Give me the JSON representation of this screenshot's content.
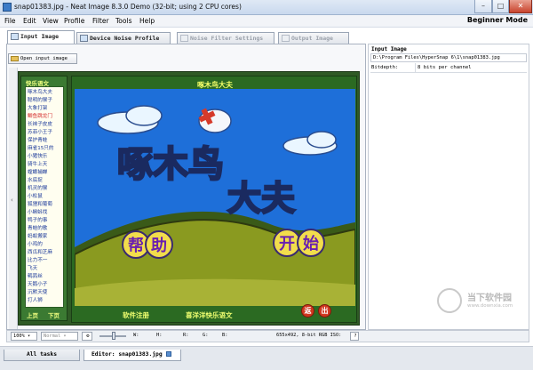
{
  "window": {
    "title": "snap01383.jpg - Neat Image 8.3.0 Demo (32-bit; using 2 CPU cores)",
    "controls": {
      "minimize": "–",
      "maximize": "□",
      "close": "✕"
    }
  },
  "menu": {
    "items": [
      "File",
      "Edit",
      "View",
      "Profile",
      "Filter",
      "Tools",
      "Help"
    ],
    "mode": "Beginner Mode"
  },
  "tabs": [
    {
      "label": "Input Image",
      "state": "active"
    },
    {
      "label": "Device Noise Profile",
      "state": "normal"
    },
    {
      "label": "Noise Filter Settings",
      "state": "disabled"
    },
    {
      "label": "Output Image",
      "state": "disabled"
    }
  ],
  "toolbar": {
    "open_label": "Open input image"
  },
  "image_content": {
    "sidebar_title": "快乐语文",
    "sidebar_items": [
      "啄木鸟大夫",
      "聪明的猴子",
      "大象打架",
      "鲫鱼跳龙门",
      "长袜子皮皮",
      "苏菲小王子",
      "保护青蛙",
      "麻雀15只的",
      "小猪快乐",
      "骑牛上天",
      "螳螂捕蝉",
      "水底捉",
      "机灵的猴",
      "小松鼠",
      "狐狸和葡萄",
      "小蝌蚪找",
      "鸭子的事",
      "青蛙的歌",
      "蚂蚁搬家",
      "小鸡的",
      "西瓜和芝麻",
      "比力不一",
      "飞天",
      "鹌鹑丝",
      "天鹅小子",
      "沉默天使",
      "打人狮"
    ],
    "sidebar_prev": "上页",
    "sidebar_next": "下页",
    "game_title": "啄木鸟大夫",
    "big_title_1": "啄木鸟",
    "big_title_2": "大夫",
    "help_1": "帮",
    "help_2": "助",
    "start_1": "开",
    "start_2": "始",
    "footer_left": "软件注册",
    "footer_right": "喜洋洋快乐语文",
    "btn_back": "返",
    "btn_exit": "出"
  },
  "right_panel": {
    "heading": "Input Image",
    "path": "D:\\Program Files\\HyperSnap 6\\1\\snap01383.jpg",
    "bitdepth_label": "Bitdepth:",
    "bitdepth_value": "8 bits per channel"
  },
  "statusbar": {
    "zoom": "100%",
    "view_mode": "Normal",
    "w_label": "W:",
    "h_label": "H:",
    "r_label": "R:",
    "g_label": "G:",
    "b_label": "B:",
    "info": "655x492, 8-bit RGB ISO:",
    "help": "?"
  },
  "taskbar": {
    "tabs": [
      {
        "label": "All tasks"
      },
      {
        "label": "Editor: snap01383.jpg"
      }
    ]
  },
  "watermark": {
    "line1": "当下软件园",
    "line2": "www.downxia.com"
  },
  "colors": {
    "sky": "#1e6fd9",
    "hill": "#8a9a20",
    "frame_green": "#2b6a22",
    "title_yellow": "#f5ff6a",
    "button_red": "#d0371f"
  }
}
